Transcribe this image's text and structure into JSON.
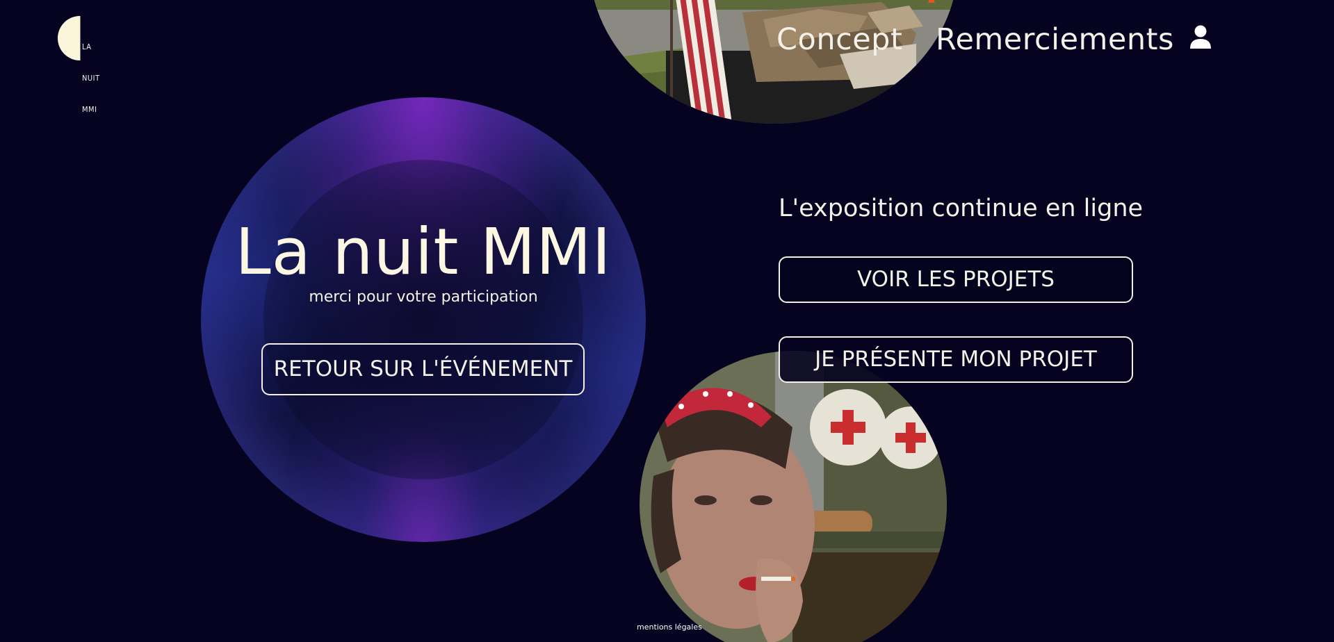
{
  "brand": {
    "logo_lines": [
      "LA",
      "NUIT",
      "MMI"
    ],
    "logo_color": "#fbf5dc"
  },
  "nav": {
    "items": [
      {
        "label": "Concept"
      },
      {
        "label": "Remerciements"
      }
    ],
    "account_icon": "user-icon"
  },
  "hero": {
    "title": "La nuit MMI",
    "subtitle": "merci pour votre participation",
    "button_label": "RETOUR SUR L'ÉVÉNEMENT"
  },
  "aside": {
    "heading": "L'exposition continue en ligne",
    "buttons": [
      {
        "label": "VOIR LES PROJETS"
      },
      {
        "label": "JE PRÉSENTE MON PROJET"
      }
    ]
  },
  "footer": {
    "legal_label": "mentions légales"
  },
  "colors": {
    "background": "#05031f",
    "text": "#f4f1e8",
    "accent_purple": "#6e28aa",
    "accent_blue": "#28328c"
  }
}
